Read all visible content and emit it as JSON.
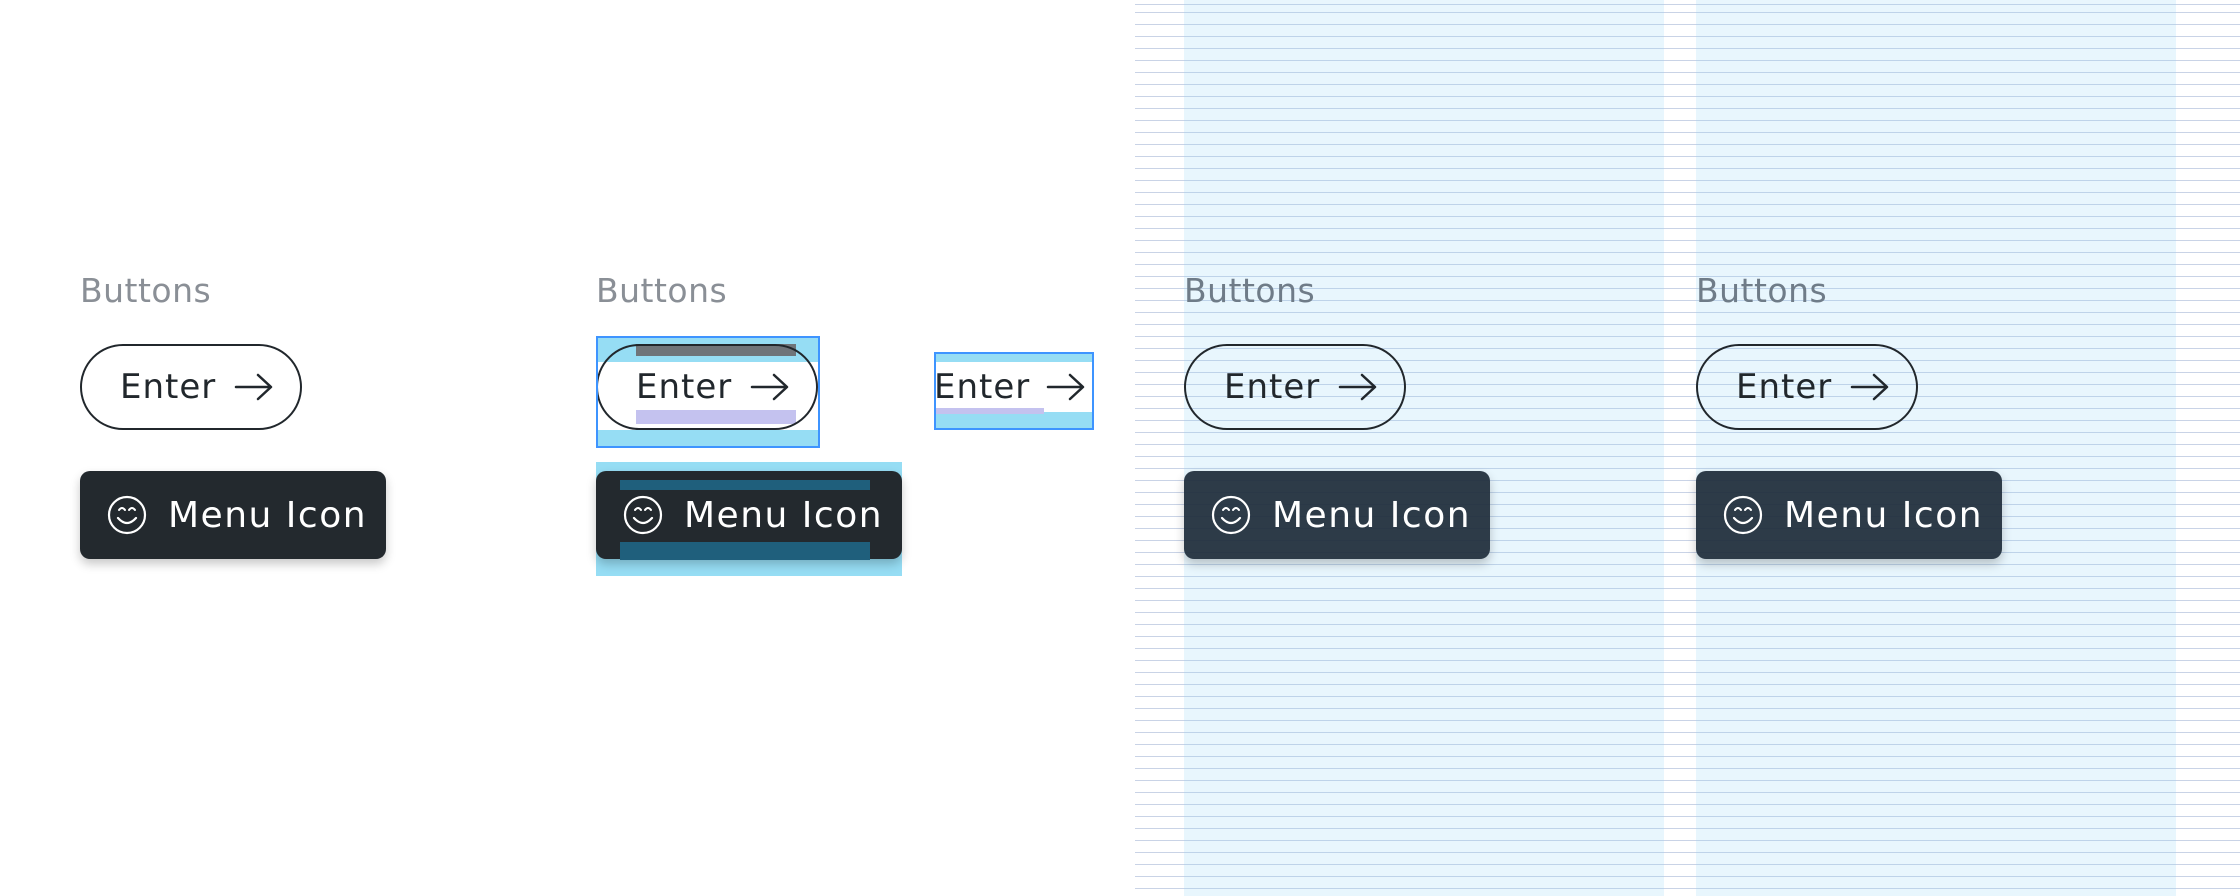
{
  "sections": [
    {
      "heading": "Buttons",
      "enter_button": {
        "label": "Enter",
        "icon": "arrow-right-icon"
      },
      "menu_button": {
        "label": "Menu Icon",
        "icon": "smiley-icon"
      }
    },
    {
      "heading": "Buttons",
      "enter_button": {
        "label": "Enter",
        "icon": "arrow-right-icon"
      },
      "menu_button": {
        "label": "Menu Icon",
        "icon": "smiley-icon"
      },
      "inline_enter": {
        "label": "Enter",
        "icon": "arrow-right-icon"
      }
    },
    {
      "heading": "Buttons",
      "enter_button": {
        "label": "Enter",
        "icon": "arrow-right-icon"
      },
      "menu_button": {
        "label": "Menu Icon",
        "icon": "smiley-icon"
      }
    },
    {
      "heading": "Buttons",
      "enter_button": {
        "label": "Enter",
        "icon": "arrow-right-icon"
      },
      "menu_button": {
        "label": "Menu Icon",
        "icon": "smiley-icon"
      }
    }
  ],
  "colors": {
    "text_dark": "#21272c",
    "button_dark": "#23292e",
    "heading_gray": "#8a8f96",
    "grid_line": "#c9d3e6",
    "grid_column": "#e9f7fd",
    "selection_blue": "#3e94ff",
    "highlight_cyan": "#96ddf4"
  }
}
